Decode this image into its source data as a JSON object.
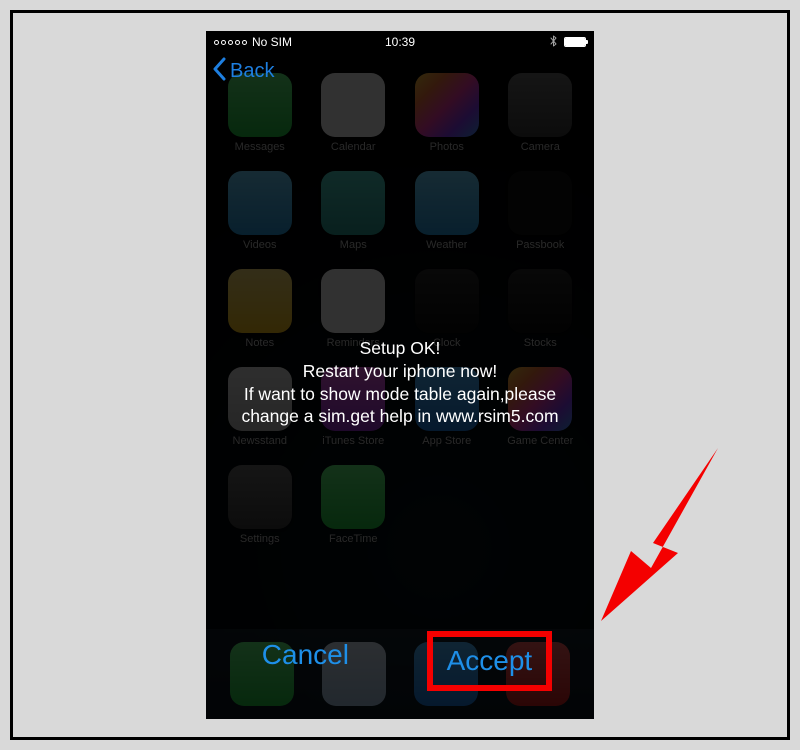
{
  "status": {
    "carrier": "No SIM",
    "time": "10:39"
  },
  "nav": {
    "back_label": "Back"
  },
  "alert": {
    "message": "Setup OK!\nRestart your iphone now!\nIf want to show mode table again,please change a sim.get help in www.rsim5.com"
  },
  "buttons": {
    "cancel": "Cancel",
    "accept": "Accept"
  },
  "apps": [
    {
      "label": "Messages",
      "tile_class": "t-green"
    },
    {
      "label": "Calendar",
      "tile_class": "t-white"
    },
    {
      "label": "Photos",
      "tile_class": "t-multi"
    },
    {
      "label": "Camera",
      "tile_class": "t-gray"
    },
    {
      "label": "Videos",
      "tile_class": "t-sky"
    },
    {
      "label": "Maps",
      "tile_class": "t-teal"
    },
    {
      "label": "Weather",
      "tile_class": "t-sky"
    },
    {
      "label": "Passbook",
      "tile_class": "t-dark"
    },
    {
      "label": "Notes",
      "tile_class": "t-yellow"
    },
    {
      "label": "Reminders",
      "tile_class": "t-white"
    },
    {
      "label": "Clock",
      "tile_class": "t-black"
    },
    {
      "label": "Stocks",
      "tile_class": "t-black"
    },
    {
      "label": "Newsstand",
      "tile_class": "t-ltgray"
    },
    {
      "label": "iTunes Store",
      "tile_class": "t-purple"
    },
    {
      "label": "App Store",
      "tile_class": "t-blue"
    },
    {
      "label": "Game Center",
      "tile_class": "t-multi"
    },
    {
      "label": "Settings",
      "tile_class": "t-gray"
    },
    {
      "label": "FaceTime",
      "tile_class": "t-green"
    }
  ],
  "dock": [
    {
      "name": "phone-app",
      "tile_class": "t-green"
    },
    {
      "name": "mail-app",
      "tile_class": "t-mail"
    },
    {
      "name": "safari-app",
      "tile_class": "t-blue"
    },
    {
      "name": "music-app",
      "tile_class": "t-red"
    }
  ],
  "annotation": {
    "highlight_color": "#f40000"
  }
}
